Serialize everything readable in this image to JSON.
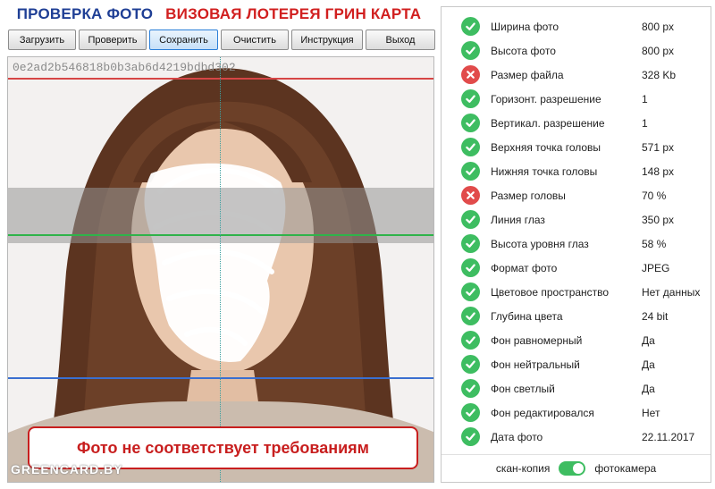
{
  "header": {
    "title_left": "ПРОВЕРКА ФОТО",
    "title_right": "ВИЗОВАЯ ЛОТЕРЕЯ ГРИН КАРТА"
  },
  "toolbar": {
    "buttons": [
      "Загрузить",
      "Проверить",
      "Сохранить",
      "Очистить",
      "Инструкция",
      "Выход"
    ],
    "active": "Сохранить"
  },
  "photo": {
    "hash": "0e2ad2b546818b0b3ab6d4219bdbd302",
    "verdict": "Фото не соответствует требованиям",
    "watermark": "GREENCARD.BY"
  },
  "checks": [
    {
      "label": "Ширина фото",
      "value": "800 px",
      "status": "ok"
    },
    {
      "label": "Высота фото",
      "value": "800 px",
      "status": "ok"
    },
    {
      "label": "Размер файла",
      "value": "328 Kb",
      "status": "fail"
    },
    {
      "label": "Горизонт. разрешение",
      "value": "1",
      "status": "ok"
    },
    {
      "label": "Вертикал. разрешение",
      "value": "1",
      "status": "ok"
    },
    {
      "label": "Верхняя точка головы",
      "value": "571 px",
      "status": "ok"
    },
    {
      "label": "Нижняя точка головы",
      "value": "148 px",
      "status": "ok"
    },
    {
      "label": "Размер головы",
      "value": "70 %",
      "status": "fail"
    },
    {
      "label": "Линия глаз",
      "value": "350 px",
      "status": "ok"
    },
    {
      "label": "Высота уровня глаз",
      "value": "58 %",
      "status": "ok"
    },
    {
      "label": "Формат фото",
      "value": "JPEG",
      "status": "ok"
    },
    {
      "label": "Цветовое пространство",
      "value": "Нет данных",
      "status": "ok"
    },
    {
      "label": "Глубина цвета",
      "value": "24 bit",
      "status": "ok"
    },
    {
      "label": "Фон равномерный",
      "value": "Да",
      "status": "ok"
    },
    {
      "label": "Фон нейтральный",
      "value": "Да",
      "status": "ok"
    },
    {
      "label": "Фон светлый",
      "value": "Да",
      "status": "ok"
    },
    {
      "label": "Фон редактировался",
      "value": "Нет",
      "status": "ok"
    },
    {
      "label": "Дата фото",
      "value": "22.11.2017",
      "status": "ok"
    }
  ],
  "mode": {
    "left_label": "скан-копия",
    "right_label": "фотокамера",
    "selected": "фотокамера"
  },
  "colors": {
    "ok": "#3ebd61",
    "fail": "#e14b4b",
    "title_blue": "#1f3f95",
    "title_red": "#d11f1f"
  }
}
